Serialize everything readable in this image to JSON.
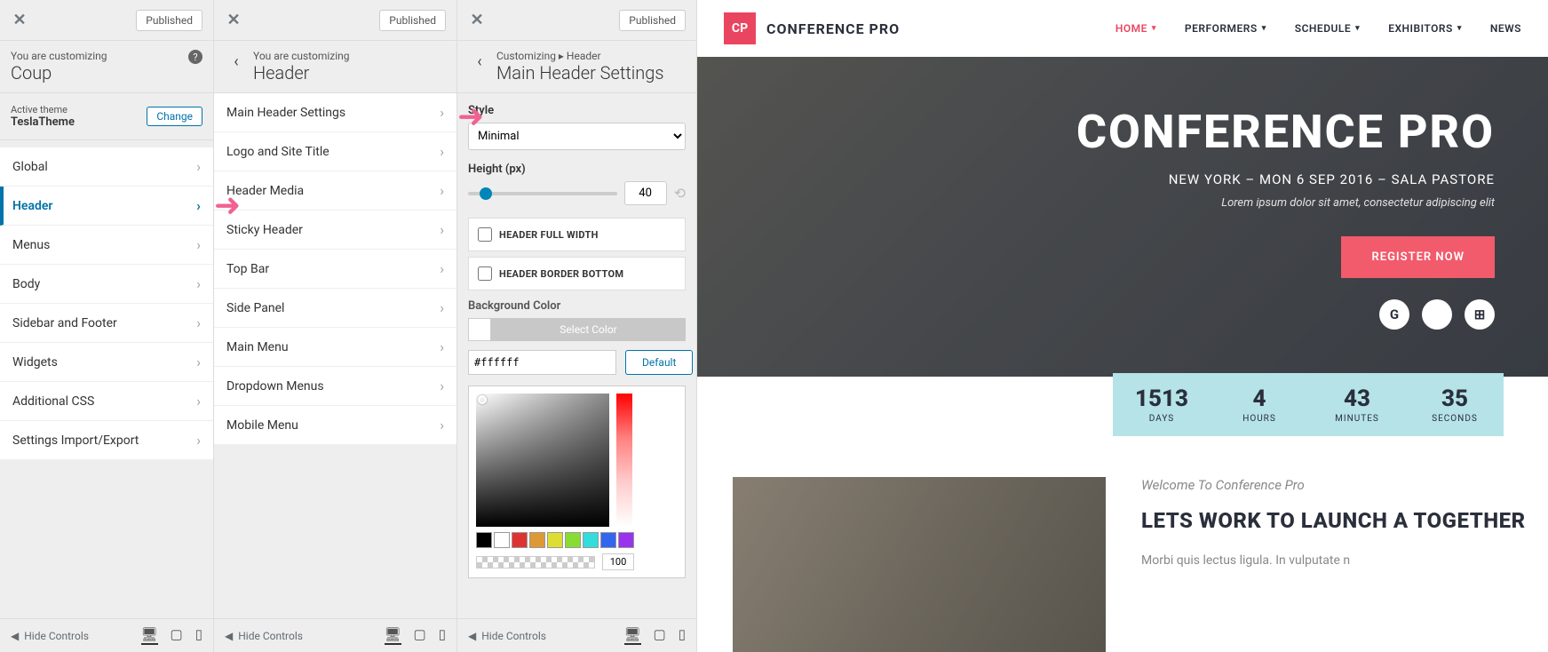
{
  "panel1": {
    "published": "Published",
    "customizing": "You are customizing",
    "title": "Coup",
    "active_theme_label": "Active theme",
    "active_theme_name": "TeslaTheme",
    "change": "Change",
    "items": [
      "Global",
      "Header",
      "Menus",
      "Body",
      "Sidebar and Footer",
      "Widgets",
      "Additional CSS",
      "Settings Import/Export"
    ],
    "active_index": 1,
    "hide_controls": "Hide Controls"
  },
  "panel2": {
    "published": "Published",
    "customizing": "You are customizing",
    "title": "Header",
    "items": [
      "Main Header Settings",
      "Logo and Site Title",
      "Header Media",
      "Sticky Header",
      "Top Bar",
      "Side Panel",
      "Main Menu",
      "Dropdown Menus",
      "Mobile Menu"
    ],
    "hide_controls": "Hide Controls"
  },
  "panel3": {
    "published": "Published",
    "breadcrumb": "Customizing ▸ Header",
    "title": "Main Header Settings",
    "style_label": "Style",
    "style_value": "Minimal",
    "height_label": "Height (px)",
    "height_value": "40",
    "checkbox1": "HEADER FULL WIDTH",
    "checkbox2": "HEADER BORDER BOTTOM",
    "bg_label": "Background Color",
    "select_color": "Select Color",
    "hex_value": "#ffffff",
    "default_btn": "Default",
    "alpha_value": "100",
    "swatches": [
      "#000000",
      "#ffffff",
      "#d33",
      "#d93",
      "#dd3",
      "#8d3",
      "#3dd",
      "#36e",
      "#93e"
    ],
    "hide_controls": "Hide Controls"
  },
  "preview": {
    "logo": "CP",
    "brand": "CONFERENCE PRO",
    "menu": [
      "HOME",
      "PERFORMERS",
      "SCHEDULE",
      "EXHIBITORS",
      "NEWS"
    ],
    "hero_title": "CONFERENCE PRO",
    "hero_sub": "NEW YORK – MON 6 SEP 2016 – SALA PASTORE",
    "hero_tag": "Lorem ipsum dolor sit amet, consectetur adipiscing elit",
    "register": "REGISTER NOW",
    "social": [
      "G",
      "",
      ""
    ],
    "countdown": [
      {
        "num": "1513",
        "lbl": "DAYS"
      },
      {
        "num": "4",
        "lbl": "HOURS"
      },
      {
        "num": "43",
        "lbl": "MINUTES"
      },
      {
        "num": "35",
        "lbl": "SECONDS"
      }
    ],
    "kicker": "Welcome To Conference Pro",
    "content_title": "LETS WORK TO LAUNCH A TOGETHER",
    "content_body": "Morbi quis lectus ligula. In vulputate n"
  }
}
